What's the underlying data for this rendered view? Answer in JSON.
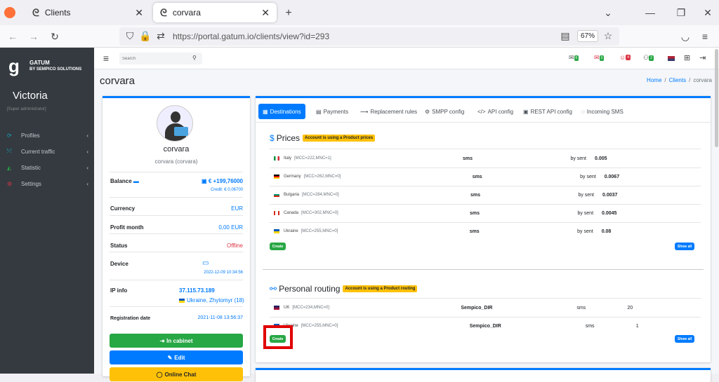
{
  "browser": {
    "tabs": [
      {
        "title": "Clients"
      },
      {
        "title": "corvara"
      }
    ],
    "url": "https://portal.gatum.io/clients/view?id=293",
    "zoom": "67%"
  },
  "sidebar": {
    "brand_title": "GATUM",
    "brand_sub": "BY SEMPICO SOLUTIONS",
    "user_name": "Victoria",
    "user_role": "[Super administrator]",
    "items": [
      {
        "label": "Profiles"
      },
      {
        "label": "Current traffic"
      },
      {
        "label": "Statistic"
      },
      {
        "label": "Settings"
      }
    ]
  },
  "topnav": {
    "search_placeholder": "Search",
    "counts": [
      "6",
      "3",
      "4",
      "2"
    ]
  },
  "page": {
    "title": "corvara",
    "breadcrumb": {
      "home": "Home",
      "clients": "Clients",
      "current": "corvara"
    }
  },
  "profile": {
    "name": "corvara",
    "subname": "corvara (corvara)",
    "balance_label": "Balance",
    "balance_value": "€ +199,76000",
    "credit": "Credit: € 0,06700",
    "currency_label": "Currency",
    "currency_value": "EUR",
    "profit_label": "Profit month",
    "profit_value": "0,00 EUR",
    "status_label": "Status",
    "status_value": "Offline",
    "device_label": "Device",
    "device_time": "2022-12-09 10:34:56",
    "ip_label": "IP info",
    "ip_value": "37.115.73.189",
    "ip_location": "Ukraine, Zhytomyr (18)",
    "reg_label": "Registration date",
    "reg_value": "2021-11-08 13:56:37",
    "btn_cabinet": "In cabinet",
    "btn_edit": "Edit",
    "btn_third": "Online Chat"
  },
  "tabs": [
    "Destinations",
    "Payments",
    "Replacement rules",
    "SMPP config",
    "API config",
    "REST API config",
    "Incoming SMS"
  ],
  "prices": {
    "title": "Prices",
    "badge": "Account is using a Product prices",
    "rows": [
      {
        "country": "Italy",
        "mcc": "[MCC=222,MNC=1]",
        "type": "sms",
        "method": "by sent",
        "price": "0.005"
      },
      {
        "country": "Germany",
        "mcc": "[MCC=262,MNC=0]",
        "type": "sms",
        "method": "by sent",
        "price": "0.0067"
      },
      {
        "country": "Bulgaria",
        "mcc": "[MCC=284,MNC=0]",
        "type": "sms",
        "method": "by sent",
        "price": "0.0037"
      },
      {
        "country": "Canada",
        "mcc": "[MCC=302,MNC=0]",
        "type": "sms",
        "method": "by sent",
        "price": "0.0045"
      },
      {
        "country": "Ukraine",
        "mcc": "[MCC=255,MNC=0]",
        "type": "sms",
        "method": "by sent",
        "price": "0.08"
      }
    ],
    "create": "Create",
    "show_all": "Show all"
  },
  "routing": {
    "title": "Personal routing",
    "badge": "Account is using a Product routing",
    "rows": [
      {
        "country": "UK",
        "mcc": "[MCC=234,MNC=0]",
        "route": "Sempico_DIR",
        "type": "sms",
        "priority": "20"
      },
      {
        "country": "Ukraine",
        "mcc": "[MCC=255,MNC=0]",
        "route": "Sempico_DIR",
        "type": "sms",
        "priority": "1"
      }
    ],
    "create": "Create",
    "show_all": "Show all"
  },
  "colors": {
    "primary": "#007bff",
    "success": "#28a745",
    "warning": "#ffc107",
    "danger": "#dc3545",
    "sidebar": "#343a40",
    "highlight": "#e00000"
  }
}
